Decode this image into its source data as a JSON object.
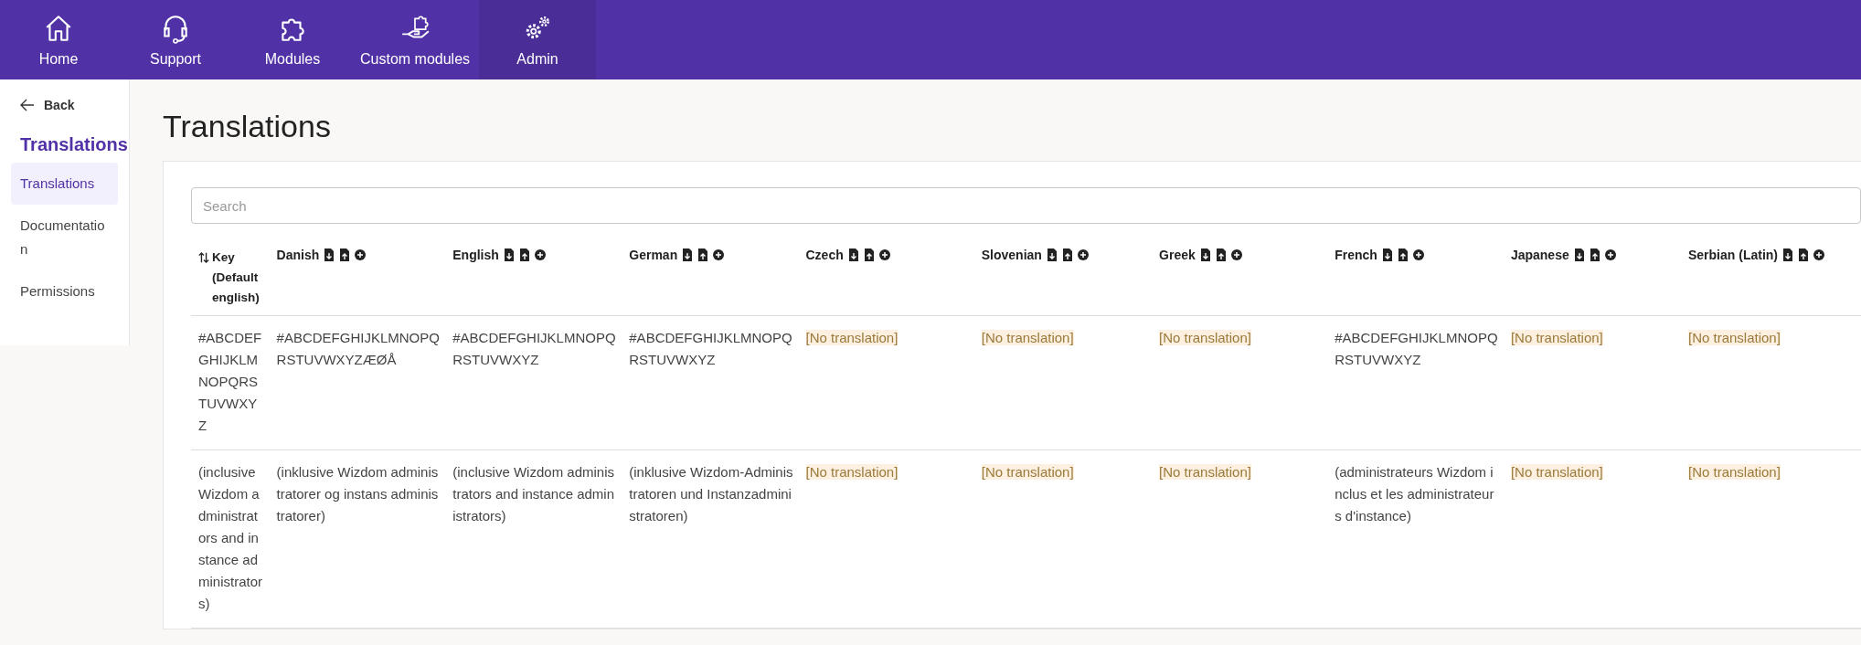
{
  "nav": [
    {
      "label": "Home",
      "kind": "home",
      "selected": false
    },
    {
      "label": "Support",
      "kind": "headset",
      "selected": false
    },
    {
      "label": "Modules",
      "kind": "puzzle",
      "selected": false
    },
    {
      "label": "Custom modules",
      "kind": "hand",
      "selected": false
    },
    {
      "label": "Admin",
      "kind": "gears",
      "selected": true
    }
  ],
  "sidebar": {
    "back": "Back",
    "heading": "Translations",
    "items": [
      {
        "label": "Translations",
        "selected": true
      },
      {
        "label": "Documentation",
        "selected": false
      },
      {
        "label": "Permissions",
        "selected": false
      }
    ]
  },
  "title": "Translations",
  "search": {
    "placeholder": "Search"
  },
  "table": {
    "key_column": "Key (Default english)",
    "languages": [
      "Danish",
      "English",
      "German",
      "Czech",
      "Slovenian",
      "Greek",
      "French",
      "Japanese",
      "Serbian (Latin)"
    ],
    "rows": [
      {
        "key": "#ABCDEFGHIJKLMNOPQRSTUVWXYZ",
        "cells": [
          {
            "text": "#ABCDEFGHIJKLMNOPQRSTUVWXYZÆØÅ",
            "missing": false
          },
          {
            "text": "#ABCDEFGHIJKLMNOPQRSTUVWXYZ",
            "missing": false
          },
          {
            "text": "#ABCDEFGHIJKLMNOPQRSTUVWXYZ",
            "missing": false
          },
          {
            "text": "[No translation]",
            "missing": true
          },
          {
            "text": "[No translation]",
            "missing": true
          },
          {
            "text": "[No translation]",
            "missing": true
          },
          {
            "text": "#ABCDEFGHIJKLMNOPQRSTUVWXYZ",
            "missing": false
          },
          {
            "text": "[No translation]",
            "missing": true
          },
          {
            "text": "[No translation]",
            "missing": true
          }
        ]
      },
      {
        "key": "(inclusive Wizdom administrators and instance administrators)",
        "cells": [
          {
            "text": "(inklusive Wizdom administratorer og instans administratorer)",
            "missing": false
          },
          {
            "text": "(inclusive Wizdom administrators and instance administrators)",
            "missing": false
          },
          {
            "text": "(inklusive Wizdom-Administratoren und Instanzadministratoren)",
            "missing": false
          },
          {
            "text": "[No translation]",
            "missing": true
          },
          {
            "text": "[No translation]",
            "missing": true
          },
          {
            "text": "[No translation]",
            "missing": true
          },
          {
            "text": "(administrateurs Wizdom inclus et les administrateurs d'instance)",
            "missing": false
          },
          {
            "text": "[No translation]",
            "missing": true
          },
          {
            "text": "[No translation]",
            "missing": true
          }
        ]
      }
    ]
  }
}
